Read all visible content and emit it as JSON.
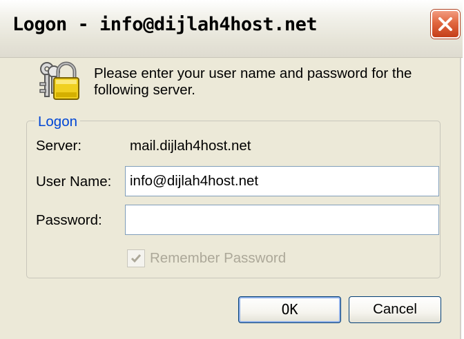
{
  "window": {
    "title": "Logon - info@dijlah4host.net"
  },
  "icons": {
    "close": "close-x-icon",
    "lock": "keys-padlock-icon"
  },
  "intro": {
    "message": "Please enter your user name and password for the following server."
  },
  "logon_group": {
    "legend": "Logon",
    "server_label": "Server:",
    "server_value": "mail.dijlah4host.net",
    "username_label": "User Name:",
    "username_value": "info@dijlah4host.net",
    "password_label": "Password:",
    "password_value": "",
    "remember_label": "Remember Password",
    "remember_checked": true,
    "remember_disabled": true
  },
  "buttons": {
    "ok": "OK",
    "cancel": "Cancel"
  },
  "colors": {
    "dialog_background": "#ece9d8",
    "legend_blue": "#0046d5",
    "close_red": "#e1673f",
    "disabled_text": "#aca899",
    "padlock_gold": "#f0d020"
  }
}
